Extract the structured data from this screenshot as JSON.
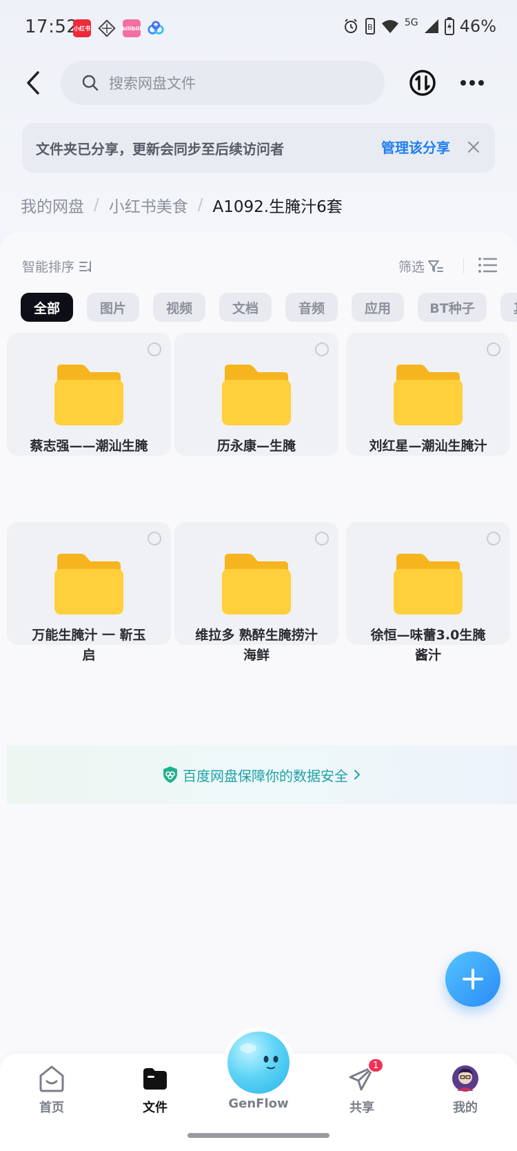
{
  "status_bar": {
    "time": "17:52",
    "app_icons": [
      "xiaohongshu-app-icon",
      "compass-app-icon",
      "bilibili-app-icon",
      "baidu-netdisk-app-icon"
    ],
    "xiaohongshu_text": "小红书",
    "bilibili_text": "bilibili",
    "network": "5G",
    "battery": "46%"
  },
  "topbar": {
    "search_placeholder": "搜索网盘文件"
  },
  "share_banner": {
    "text": "文件夹已分享，更新会同步至后续访问者",
    "manage_label": "管理该分享"
  },
  "breadcrumb": {
    "items": [
      "我的网盘",
      "小红书美食"
    ],
    "current": "A1092.生腌汁6套"
  },
  "toolbar": {
    "sort_label": "智能排序",
    "filter_label": "筛选"
  },
  "tabs": [
    {
      "label": "全部",
      "active": true
    },
    {
      "label": "图片",
      "active": false
    },
    {
      "label": "视频",
      "active": false
    },
    {
      "label": "文档",
      "active": false
    },
    {
      "label": "音频",
      "active": false
    },
    {
      "label": "应用",
      "active": false
    },
    {
      "label": "BT种子",
      "active": false
    },
    {
      "label": "其他",
      "active": false
    }
  ],
  "folders": [
    {
      "name": "蔡志强——潮汕生腌"
    },
    {
      "name": "历永康—生腌"
    },
    {
      "name": "刘红星—潮汕生腌汁"
    },
    {
      "name_line1": "万能生腌汁 一 靳玉",
      "name_line2": "启"
    },
    {
      "name_line1": "维拉多 熟醉生腌捞汁",
      "name_line2": "海鲜"
    },
    {
      "name_line1": "徐恒—味蕾3.0生腌",
      "name_line2": "酱汁"
    }
  ],
  "security_banner": {
    "text": "百度网盘保障你的数据安全"
  },
  "bottom_nav": {
    "home": "首页",
    "files": "文件",
    "genflow": "GenFlow",
    "share": "共享",
    "share_badge": "1",
    "mine": "我的"
  },
  "colors": {
    "accent": "#1f7ff0",
    "active_tab": "#0d0e17",
    "folder": "#ffc83a",
    "badge": "#f23158",
    "security": "#1ea2a8"
  }
}
